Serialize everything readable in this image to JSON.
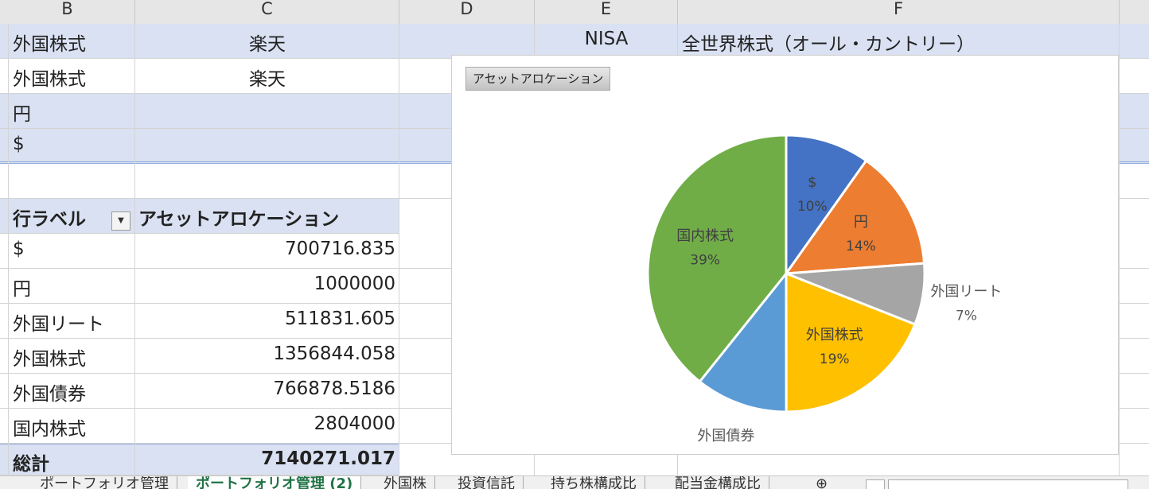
{
  "columns": [
    "B",
    "C",
    "D",
    "E",
    "F"
  ],
  "top_rows": [
    {
      "b": "外国株式",
      "c": "楽天",
      "e": "NISA",
      "f": "全世界株式（オール・カントリー）"
    },
    {
      "b": "外国株式",
      "c": "楽天"
    },
    {
      "b": "円"
    },
    {
      "b": "$"
    }
  ],
  "pivot": {
    "header_label": "行ラベル",
    "header_value": "アセットアロケーション",
    "rows": [
      {
        "label": "$",
        "value": "700716.835"
      },
      {
        "label": "円",
        "value": "1000000"
      },
      {
        "label": "外国リート",
        "value": "511831.605"
      },
      {
        "label": "外国株式",
        "value": "1356844.058"
      },
      {
        "label": "外国債券",
        "value": "766878.5186"
      },
      {
        "label": "国内株式",
        "value": "2804000"
      }
    ],
    "total_label": "総計",
    "total_value": "7140271.017"
  },
  "chart_tag": "アセットアロケーション",
  "chart_data": {
    "type": "pie",
    "slices": [
      {
        "label": "$",
        "percent": "10%",
        "value": 700716.835,
        "color": "#4472c4"
      },
      {
        "label": "円",
        "percent": "14%",
        "value": 1000000,
        "color": "#ed7d31"
      },
      {
        "label": "外国リート",
        "percent": "7%",
        "value": 511831.605,
        "color": "#a5a5a5"
      },
      {
        "label": "外国株式",
        "percent": "19%",
        "value": 1356844.058,
        "color": "#ffc000"
      },
      {
        "label": "外国債券",
        "percent": "11%",
        "value": 766878.5186,
        "color": "#5b9bd5"
      },
      {
        "label": "国内株式",
        "percent": "39%",
        "value": 2804000,
        "color": "#70ad47"
      }
    ]
  },
  "sheet_tabs": [
    "ポートフォリオ管理",
    "ポートフォリオ管理 (2)",
    "外国株",
    "投資信託",
    "持ち株構成比",
    "配当金構成比"
  ],
  "active_tab": 1
}
